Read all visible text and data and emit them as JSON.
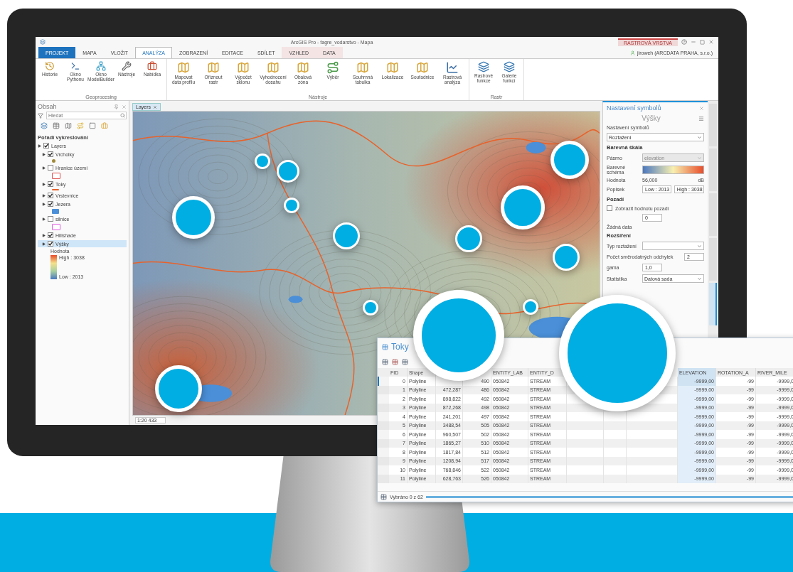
{
  "window": {
    "title": "ArcGIS Pro - fagre_vodarstvo - Mapa",
    "contextual_tab": "RASTROVÁ VRSTVA",
    "user": "jiroweh (ARCDATA PRAHA, s.r.o.)"
  },
  "tabs": [
    {
      "label": "PROJEKT",
      "kind": "file",
      "selected": false
    },
    {
      "label": "MAPA",
      "kind": "tab",
      "selected": false
    },
    {
      "label": "VLOŽIT",
      "kind": "tab",
      "selected": false
    },
    {
      "label": "ANALÝZA",
      "kind": "tab",
      "selected": true
    },
    {
      "label": "ZOBRAZENÍ",
      "kind": "tab",
      "selected": false
    },
    {
      "label": "EDITACE",
      "kind": "tab",
      "selected": false
    },
    {
      "label": "SDÍLET",
      "kind": "tab",
      "selected": false
    },
    {
      "label": "VZHLED",
      "kind": "context",
      "selected": false
    },
    {
      "label": "DATA",
      "kind": "context",
      "selected": false
    }
  ],
  "ribbon": {
    "groups": [
      {
        "label": "Geoprocesing",
        "buttons": [
          "Historie",
          "Okno Pythonu",
          "Okno ModelBuilder",
          "Nástroje",
          "Nabídka"
        ]
      },
      {
        "label": "Nástroje",
        "buttons": [
          "Mapovat data profilu",
          "Oříznout rastr",
          "Výpočet sklonu",
          "Vyhodnocení dosahu",
          "Obalová zóna",
          "Výběr",
          "Souhrnná tabulka",
          "Lokalizace",
          "Souřadnice",
          "Rastrová analýza"
        ]
      },
      {
        "label": "Rastr",
        "buttons": [
          "Rastrové funkce",
          "Galerie funkcí"
        ]
      }
    ]
  },
  "contents": {
    "title": "Obsah",
    "search": {
      "placeholder": "Hledat"
    },
    "heading": "Pořadí vykreslování",
    "root": {
      "label": "Layers",
      "checked": true
    },
    "layers": [
      {
        "label": "Vrcholky",
        "checked": true,
        "selected": false,
        "kind": "point",
        "color": "#a08a3a"
      },
      {
        "label": "Hranice území",
        "checked": false,
        "selected": false,
        "kind": "outline",
        "color": "#e05050"
      },
      {
        "label": "Toky",
        "checked": true,
        "selected": false,
        "kind": "line",
        "color": "#e8622a"
      },
      {
        "label": "Vrstevnice",
        "checked": true,
        "selected": false,
        "kind": "none"
      },
      {
        "label": "Jezera",
        "checked": true,
        "selected": false,
        "kind": "fill",
        "color": "#4a8fd8"
      },
      {
        "label": "silnice",
        "checked": false,
        "selected": false,
        "kind": "outline",
        "color": "#e060e0"
      },
      {
        "label": "Hillshade",
        "checked": true,
        "selected": false,
        "kind": "none"
      },
      {
        "label": "Výšky",
        "checked": true,
        "selected": true,
        "kind": "ramp"
      }
    ],
    "legend": {
      "title": "Hodnota",
      "high": "High : 3038",
      "low": "Low : 2013"
    }
  },
  "map": {
    "tab": "Layers",
    "scale": "1:20 433"
  },
  "symbology": {
    "title": "Nastavení symbolů",
    "layer": "Výšky",
    "type_label": "Nastavení symbolů",
    "type_value": "Roztažení",
    "section_1": "Barevná škála",
    "band_label": "Pásmo",
    "band_value": "elevation",
    "scheme_label": "Barevné schéma",
    "value_label": "Hodnota",
    "value_1": "56,000",
    "value_2": "dB",
    "label_label": "Popisek",
    "low": "Low : 2013",
    "high": "High : 3038",
    "section_2": "Pozadí",
    "show_background": {
      "label": "Zobrazit hodnotu pozadí",
      "checked": false
    },
    "background_value": "0",
    "nodata_label": "Žádná data",
    "section_3": "Rozšíření",
    "stretch_label": "Typ roztažení",
    "stddev_label": "Počet směrodatných odchylek",
    "stddev_value": "2",
    "gamma_label": "gama",
    "gamma_value": "1,0",
    "stats_label": "Statistika",
    "stats_value": "Datová sada"
  },
  "side_tabs": [
    {
      "selected": false
    },
    {
      "selected": false
    },
    {
      "selected": false
    },
    {
      "selected": false
    },
    {
      "selected": true
    }
  ],
  "table": {
    "title": "Toky",
    "columns": [
      {
        "kind": "field",
        "label": "FID",
        "selected": false
      },
      {
        "kind": "field",
        "label": "Shape",
        "selected": false
      },
      {
        "kind": "hidden"
      },
      {
        "kind": "hidden"
      },
      {
        "kind": "field",
        "label": "ENTITY_LAB",
        "selected": false
      },
      {
        "kind": "field",
        "label": "ENTITY_D",
        "selected": false
      },
      {
        "kind": "hidden"
      },
      {
        "kind": "hidden"
      },
      {
        "kind": "hidden"
      },
      {
        "kind": "field",
        "label": "ELEVATION",
        "selected": true
      },
      {
        "kind": "field",
        "label": "ROTATION_A",
        "selected": false
      },
      {
        "kind": "field",
        "label": "RIVER_MILE",
        "selected": false
      }
    ],
    "rows": [
      {
        "selected": true,
        "cells": [
          "0",
          "Polyline",
          "",
          "490",
          "050842",
          "STREAM",
          "",
          "",
          "",
          "-9999,00",
          "-99",
          "-9999,0"
        ]
      },
      {
        "selected": false,
        "cells": [
          "1",
          "Polyline",
          "472,287",
          "486",
          "050842",
          "STREAM",
          "",
          "",
          "",
          "-9999,00",
          "-99",
          "-9999,0"
        ]
      },
      {
        "selected": false,
        "cells": [
          "2",
          "Polyline",
          "898,822",
          "492",
          "050842",
          "STREAM",
          "",
          "",
          "",
          "-9999,00",
          "-99",
          "-9999,0"
        ]
      },
      {
        "selected": false,
        "cells": [
          "3",
          "Polyline",
          "872,268",
          "498",
          "050842",
          "STREAM",
          "",
          "",
          "",
          "-9999,00",
          "-99",
          "-9999,0"
        ]
      },
      {
        "selected": false,
        "cells": [
          "4",
          "Polyline",
          "241,201",
          "497",
          "050842",
          "STREAM",
          "",
          "",
          "",
          "-9999,00",
          "-99",
          "-9999,0"
        ]
      },
      {
        "selected": false,
        "cells": [
          "5",
          "Polyline",
          "3488,54",
          "505",
          "050842",
          "STREAM",
          "",
          "",
          "",
          "-9999,00",
          "-99",
          "-9999,0"
        ]
      },
      {
        "selected": false,
        "cells": [
          "6",
          "Polyline",
          "960,507",
          "502",
          "050842",
          "STREAM",
          "",
          "",
          "",
          "-9999,00",
          "-99",
          "-9999,0"
        ]
      },
      {
        "selected": false,
        "cells": [
          "7",
          "Polyline",
          "1865,27",
          "510",
          "050842",
          "STREAM",
          "",
          "",
          "",
          "-9999,00",
          "-99",
          "-9999,0"
        ]
      },
      {
        "selected": false,
        "cells": [
          "8",
          "Polyline",
          "1817,84",
          "512",
          "050842",
          "STREAM",
          "",
          "",
          "",
          "-9999,00",
          "-99",
          "-9999,0"
        ]
      },
      {
        "selected": false,
        "cells": [
          "9",
          "Polyline",
          "1208,94",
          "517",
          "050842",
          "STREAM",
          "",
          "",
          "",
          "-9999,00",
          "-99",
          "-9999,0"
        ]
      },
      {
        "selected": false,
        "cells": [
          "10",
          "Polyline",
          "768,846",
          "522",
          "050842",
          "STREAM",
          "",
          "",
          "",
          "-9999,00",
          "-99",
          "-9999,0"
        ]
      },
      {
        "selected": false,
        "cells": [
          "11",
          "Polyline",
          "628,763",
          "526",
          "050842",
          "STREAM",
          "",
          "",
          "",
          "-9999,00",
          "-99",
          "-9999,0"
        ]
      }
    ],
    "footer": "Vybráno 0 z 62"
  }
}
